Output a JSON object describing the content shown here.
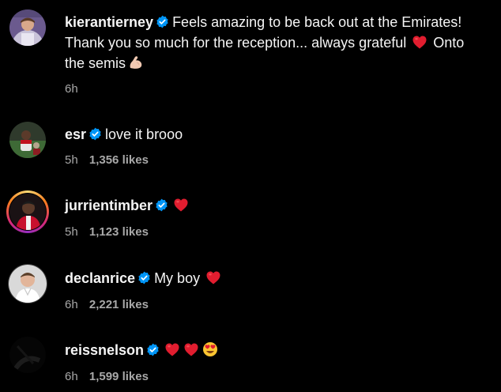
{
  "colors": {
    "background": "#000000",
    "text": "#f5f5f5",
    "muted": "#a8a8a8",
    "verified": "#0095f6",
    "heart": "#e11d2f"
  },
  "comments": [
    {
      "username": "kierantierney",
      "verified": true,
      "text_line1": "Feels amazing to be back out at the Emirates!",
      "text_line2a": "Thank you so much for the reception... always grateful",
      "text_line2b": "Onto",
      "text_line3": "the semis",
      "emojis": [
        "red-heart",
        "flexed-biceps"
      ],
      "time": "6h",
      "likes": ""
    },
    {
      "username": "esr",
      "verified": true,
      "text": "love it brooo",
      "time": "5h",
      "likes": "1,356 likes"
    },
    {
      "username": "jurrientimber",
      "verified": true,
      "text": "",
      "emojis": [
        "red-heart"
      ],
      "time": "5h",
      "likes": "1,123 likes"
    },
    {
      "username": "declanrice",
      "verified": true,
      "text": "My boy",
      "emojis": [
        "red-heart"
      ],
      "time": "6h",
      "likes": "2,221 likes"
    },
    {
      "username": "reissnelson",
      "verified": true,
      "text": "",
      "emojis": [
        "red-heart",
        "red-heart",
        "smiling-face-with-heart-eyes"
      ],
      "time": "6h",
      "likes": "1,599 likes"
    }
  ]
}
